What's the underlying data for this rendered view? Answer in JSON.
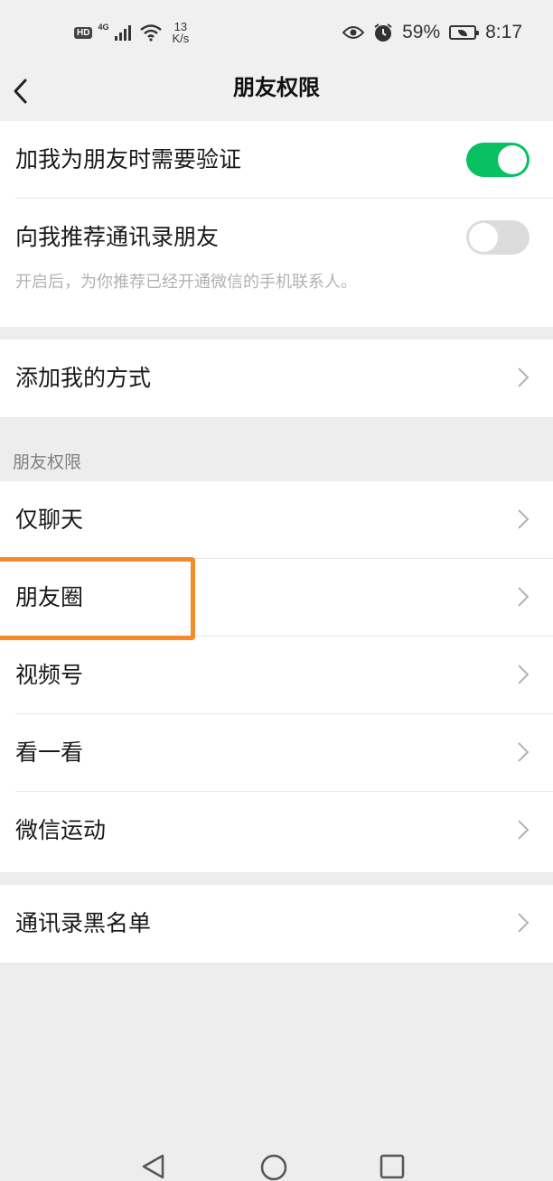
{
  "status_bar": {
    "hd": "HD",
    "signal": "4G",
    "net_speed_value": "13",
    "net_speed_unit": "K/s",
    "battery_percent": "59%",
    "time": "8:17"
  },
  "header": {
    "title": "朋友权限"
  },
  "verify_section": {
    "verify_label": "加我为朋友时需要验证",
    "verify_enabled": true,
    "recommend_label": "向我推荐通讯录朋友",
    "recommend_enabled": false,
    "recommend_hint": "开启后，为你推荐已经开通微信的手机联系人。"
  },
  "add_method": {
    "label": "添加我的方式"
  },
  "permissions": {
    "header": "朋友权限",
    "items": [
      {
        "label": "仅聊天"
      },
      {
        "label": "朋友圈"
      },
      {
        "label": "视频号"
      },
      {
        "label": "看一看"
      },
      {
        "label": "微信运动"
      }
    ]
  },
  "blacklist": {
    "label": "通讯录黑名单"
  },
  "colors": {
    "accent": "#07c160",
    "highlight": "#f58b2c"
  }
}
